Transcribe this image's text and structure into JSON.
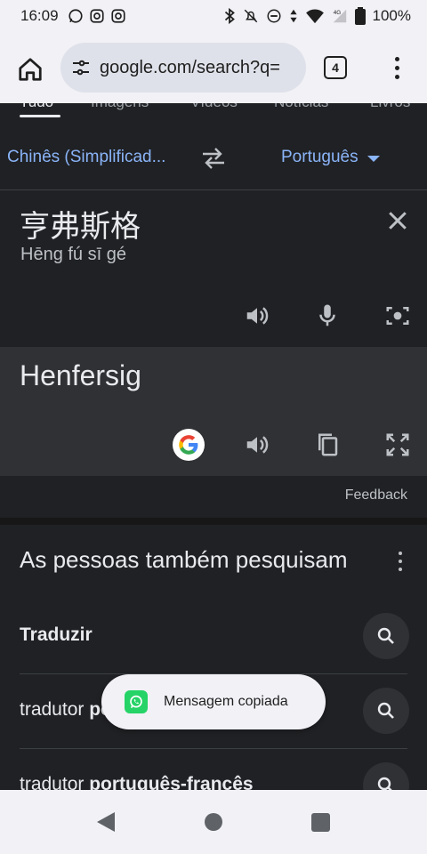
{
  "status_bar": {
    "time": "16:09",
    "battery": "100%",
    "network_label": "4G"
  },
  "browser": {
    "url": "google.com/search?q=",
    "tab_count": "4"
  },
  "search_tabs": [
    "Tudo",
    "Imagens",
    "Vídeos",
    "Notícias",
    "Livros"
  ],
  "translate": {
    "source_language": "Chinês (Simplificad...",
    "target_language": "Português",
    "source_text": "亨弗斯格",
    "source_romanization": "Hēng fú sī gé",
    "translated_text": "Henfersig",
    "feedback_label": "Feedback"
  },
  "people_also_search": {
    "title": "As pessoas também pesquisam",
    "items": [
      {
        "label": "Traduzir"
      },
      {
        "label_prefix": "tradutor ",
        "label_bold": "português"
      },
      {
        "label_prefix": "tradutor ",
        "label_bold": "português-francês"
      }
    ]
  },
  "toast": {
    "text": "Mensagem copiada"
  }
}
